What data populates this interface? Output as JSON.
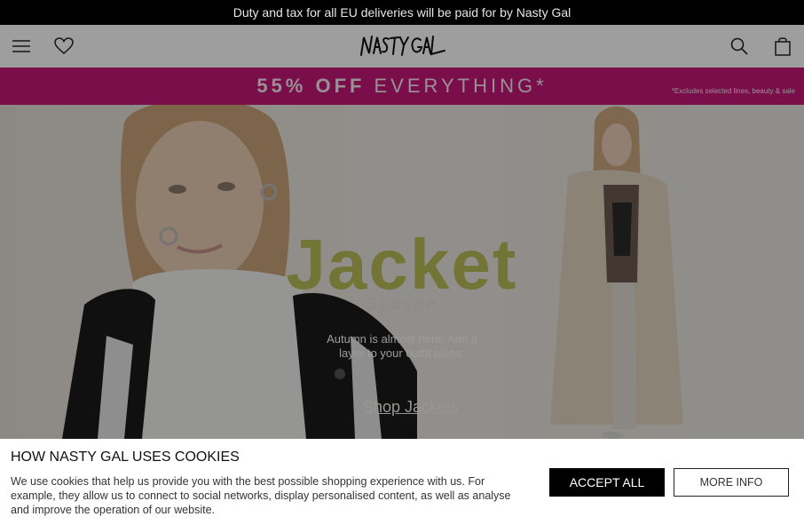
{
  "promo_strip": {
    "text": "Duty and tax for all EU deliveries will be paid for by Nasty Gal"
  },
  "header": {
    "menu_icon": "hamburger-menu-icon",
    "wishlist_icon": "heart-icon",
    "logo_text": "NASTY GAL",
    "search_icon": "search-icon",
    "bag_icon": "shopping-bag-icon"
  },
  "sale_banner": {
    "highlight": "55% OFF",
    "rest": "EVERYTHING*",
    "note": "*Excludes selected lines, beauty & sale",
    "background": "#c4187a"
  },
  "hero": {
    "title": "Jacket",
    "subtitle": "Season",
    "text": "Autumn is almost here. Add a layer to your outfit plans.",
    "cta": "Shop Jackets",
    "title_color": "#b9bd56"
  },
  "cookie_banner": {
    "title": "HOW NASTY GAL USES COOKIES",
    "text": "We use cookies that help us provide you with the best possible shopping experience with us. For example, they allow us to connect to social networks, display personalised content, as well as analyse and improve the operation of our website.",
    "accept_label": "ACCEPT ALL",
    "more_label": "MORE INFO"
  }
}
